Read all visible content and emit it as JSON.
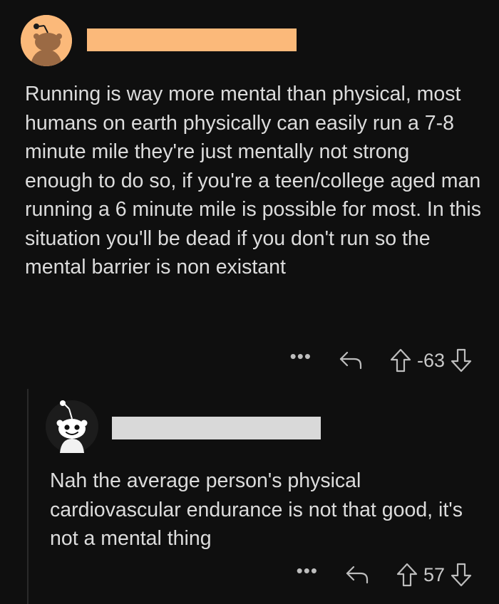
{
  "comments": [
    {
      "body": "Running is way more mental than physical, most humans on earth physically can easily run a 7-8 minute mile they're just mentally not strong enough to do so, if you're a teen/college aged man running a 6 minute mile is possible for most. In this situation you'll be dead if you don't run so the mental barrier is non existant",
      "score": "-63",
      "more_label": "•••",
      "avatar_icon": "snoo-avatar-icon",
      "redaction_color": "#fbb97a"
    },
    {
      "body": "Nah the average person's physical cardiovascular endurance is not that good, it's not a mental thing",
      "score": "57",
      "more_label": "•••",
      "avatar_icon": "snoo-avatar-icon",
      "redaction_color": "#d9d9d9"
    }
  ],
  "icons": {
    "reply": "reply-arrow-icon",
    "upvote": "upvote-arrow-icon",
    "downvote": "downvote-arrow-icon",
    "more": "more-options-icon"
  }
}
